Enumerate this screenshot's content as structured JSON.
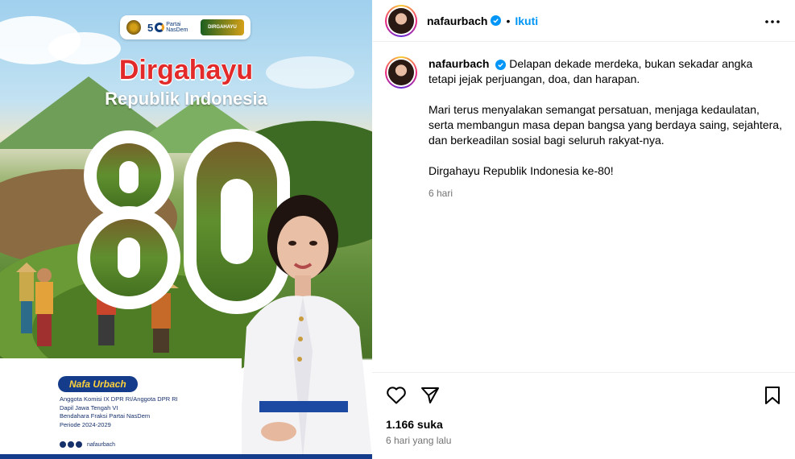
{
  "image": {
    "badge_partai": "Partai",
    "badge_nasdem": "NasDem",
    "badge_50": "5",
    "badge_merdeka": "DIRGAHAYU",
    "title_line1": "Dirgahayu",
    "title_line2": "Republik Indonesia",
    "big_number": "80",
    "name": "Nafa Urbach",
    "info_lines": [
      "Anggota Komisi IX DPR RI/Anggota DPR RI",
      "Dapil Jawa Tengah VI",
      "Bendahara Fraksi Partai NasDem",
      "Periode 2024-2029"
    ],
    "social_handle": "nafaurbach"
  },
  "header": {
    "username": "nafaurbach",
    "separator": "•",
    "follow_label": "Ikuti",
    "more_icon": "more-horizontal-icon"
  },
  "caption": {
    "username": "nafaurbach",
    "paragraphs": [
      "Delapan dekade merdeka, bukan sekadar angka tetapi jejak perjuangan, doa, dan harapan.",
      "Mari terus menyalakan semangat persatuan, menjaga kedaulatan, serta membangun masa depan bangsa yang berdaya saing, sejahtera, dan berkeadilan sosial bagi seluruh rakyat-nya.",
      "Dirgahayu Republik Indonesia ke-80!"
    ],
    "time": "6 hari"
  },
  "actions": {
    "like_icon": "heart-icon",
    "share_icon": "send-icon",
    "save_icon": "bookmark-icon",
    "likes": "1.166 suka",
    "posted": "6 hari yang lalu"
  },
  "colors": {
    "accent": "#0095f6",
    "red_title": "#e32a2a",
    "navy": "#153c8a",
    "secondary_text": "#737373"
  }
}
